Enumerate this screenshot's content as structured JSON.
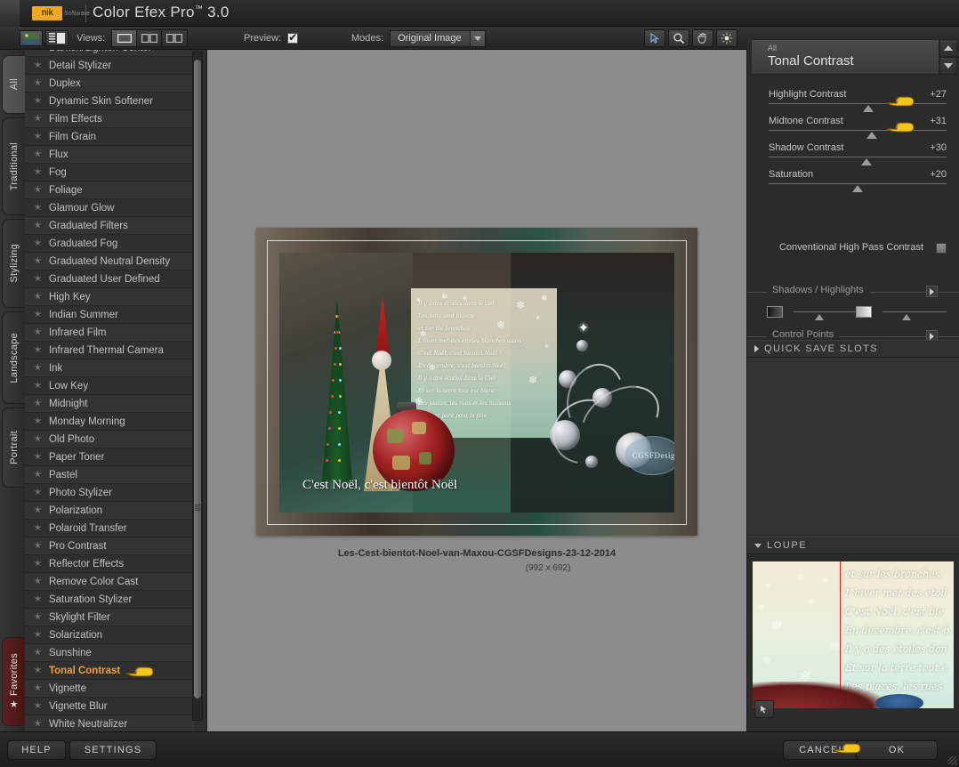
{
  "window": {
    "title": "Color Efex Pro",
    "title_tm": "™",
    "version": "3.0",
    "logo_text": "nik",
    "logo_sub": "Software"
  },
  "toolbar": {
    "views_label": "Views:",
    "preview_label": "Preview:",
    "preview_checked": true,
    "modes_label": "Modes:",
    "modes_value": "Original Image",
    "view_buttons": [
      "single-view",
      "split-view",
      "side-by-side-view"
    ],
    "selected_view": 0,
    "left_toggles": [
      "image-thumbnail-toggle",
      "list-view-toggle"
    ],
    "tools": [
      "arrow-tool",
      "zoom-tool",
      "pan-tool",
      "brightness-tool"
    ]
  },
  "category_tabs": [
    {
      "label": "All",
      "active": true
    },
    {
      "label": "Traditional",
      "active": false
    },
    {
      "label": "Stylizing",
      "active": false
    },
    {
      "label": "Landscape",
      "active": false
    },
    {
      "label": "Portrait",
      "active": false
    },
    {
      "label": "Favorites",
      "active": false,
      "favorite": true
    }
  ],
  "filters": [
    {
      "name": "Darken/Lighten Center",
      "active": false
    },
    {
      "name": "Detail Stylizer",
      "active": false
    },
    {
      "name": "Duplex",
      "active": false
    },
    {
      "name": "Dynamic Skin Softener",
      "active": false
    },
    {
      "name": "Film Effects",
      "active": false
    },
    {
      "name": "Film Grain",
      "active": false
    },
    {
      "name": "Flux",
      "active": false
    },
    {
      "name": "Fog",
      "active": false
    },
    {
      "name": "Foliage",
      "active": false
    },
    {
      "name": "Glamour Glow",
      "active": false
    },
    {
      "name": "Graduated Filters",
      "active": false
    },
    {
      "name": "Graduated Fog",
      "active": false
    },
    {
      "name": "Graduated Neutral Density",
      "active": false
    },
    {
      "name": "Graduated User Defined",
      "active": false
    },
    {
      "name": "High Key",
      "active": false
    },
    {
      "name": "Indian Summer",
      "active": false
    },
    {
      "name": "Infrared Film",
      "active": false
    },
    {
      "name": "Infrared Thermal Camera",
      "active": false
    },
    {
      "name": "Ink",
      "active": false
    },
    {
      "name": "Low Key",
      "active": false
    },
    {
      "name": "Midnight",
      "active": false
    },
    {
      "name": "Monday Morning",
      "active": false
    },
    {
      "name": "Old Photo",
      "active": false
    },
    {
      "name": "Paper Toner",
      "active": false
    },
    {
      "name": "Pastel",
      "active": false
    },
    {
      "name": "Photo Stylizer",
      "active": false
    },
    {
      "name": "Polarization",
      "active": false
    },
    {
      "name": "Polaroid Transfer",
      "active": false
    },
    {
      "name": "Pro Contrast",
      "active": false
    },
    {
      "name": "Reflector Effects",
      "active": false
    },
    {
      "name": "Remove Color Cast",
      "active": false
    },
    {
      "name": "Saturation Stylizer",
      "active": false
    },
    {
      "name": "Skylight Filter",
      "active": false
    },
    {
      "name": "Solarization",
      "active": false
    },
    {
      "name": "Sunshine",
      "active": false
    },
    {
      "name": "Tonal Contrast",
      "active": true
    },
    {
      "name": "Vignette",
      "active": false
    },
    {
      "name": "Vignette Blur",
      "active": false
    },
    {
      "name": "White Neutralizer",
      "active": false
    }
  ],
  "preview": {
    "caption_title": "Les-Cest-bientot-Noel-van-Maxou-CGSFDesigns-23-12-2014",
    "caption_dims": "(992 x 692)",
    "image_text": "C'est Noël, c'est bientôt Noël",
    "watermark": "CGSFDesigns",
    "poem_lines": [
      "Il y a des étoiles dans le ciel",
      "Les toits sont blancs",
      "et sur les branches",
      "L'hiver met des étoiles blanches aussi",
      "C'est Noël, c'est bientôt Noël !",
      "En décembre, c'est bientôt Noël",
      "Il y a des étoiles dans le Ciel",
      "Et sur la terre tout est blanc",
      "Les places, les rues et les maisons",
      "Tout est paré pour la fête"
    ]
  },
  "filter_panel": {
    "category": "All",
    "filter_name": "Tonal Contrast",
    "sliders": [
      {
        "label": "Highlight Contrast",
        "value": "+27",
        "pct": 53
      },
      {
        "label": "Midtone Contrast",
        "value": "+31",
        "pct": 55
      },
      {
        "label": "Shadow Contrast",
        "value": "+30",
        "pct": 52
      },
      {
        "label": "Saturation",
        "value": "+20",
        "pct": 47
      }
    ],
    "checkbox_label": "Conventional High Pass Contrast",
    "checkbox_checked": false,
    "shadows_highlights": {
      "title": "Shadows / Highlights",
      "shadow_pct": 33,
      "highlight_pct": 33
    },
    "control_points": {
      "title": "Control Points",
      "minus_label": "−",
      "plus_label": "+"
    },
    "quick_save_slots": "QUICK SAVE SLOTS",
    "loupe_title": "LOUPE",
    "loupe_lines": [
      "et sur les branches",
      "L'hiver met des étoil",
      "C'est Noël, c'est bie",
      "En décembre, c'est b",
      "Il y a des étoiles dan",
      "Et sur la terre tout e",
      "Les places, les rues"
    ]
  },
  "bottom": {
    "help_label": "HELP",
    "settings_label": "SETTINGS",
    "cancel_label": "CANCEL",
    "ok_label": "OK"
  },
  "colors": {
    "accent_orange": "#f0a030",
    "logo_orange": "#f0a81e",
    "cursor_yellow": "#f2c40c",
    "loupe_split_red": "#d31f1f",
    "favorites_red": "#5e1f1f"
  }
}
